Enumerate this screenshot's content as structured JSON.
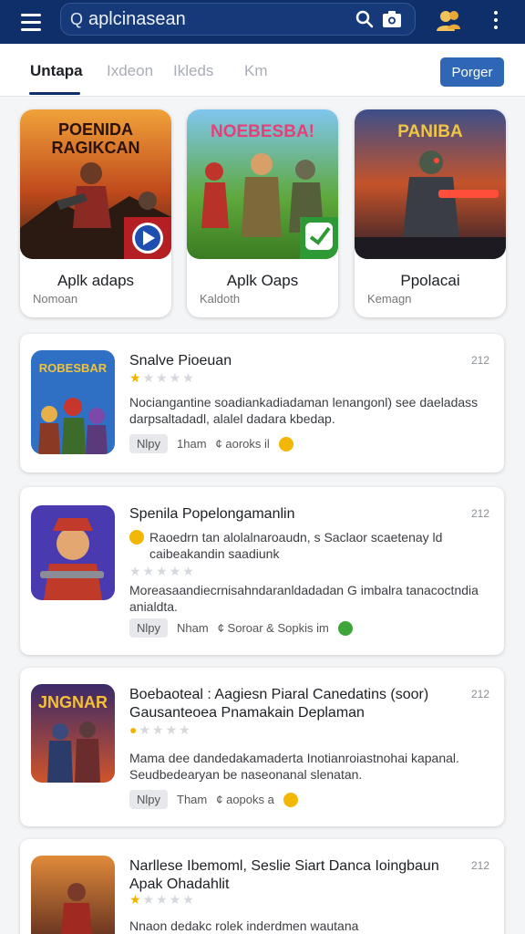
{
  "topbar": {
    "search_text": "aplcinasean",
    "search_prefix": "Q"
  },
  "tabs": [
    {
      "label": "Untapa"
    },
    {
      "label": "Ixdeon"
    },
    {
      "label": "Ikleds"
    },
    {
      "label": "Km"
    }
  ],
  "tab_button": "Porger",
  "featured": [
    {
      "title": "Aplk adaps",
      "sub": "Nomoan",
      "art_text": "POENIDA RAGIKCAN"
    },
    {
      "title": "Aplk Oaps",
      "sub": "Kaldoth",
      "art_text": "NOEBESBA!"
    },
    {
      "title": "Ppolacai",
      "sub": "Kemagn",
      "art_text": "PANIBA"
    }
  ],
  "items": [
    {
      "name": "Snalve Pioeuan",
      "num": "212",
      "rating": 1,
      "desc": "Nociangantine soadiankadiadaman lenangonl) see daeladass darpsaltadadl, alalel dadara kbedap.",
      "chip": "Nlpy",
      "meta1": "1ham",
      "meta2": "¢ aoroks il",
      "badge": "yellow",
      "art_text": "ROBESBAR"
    },
    {
      "name": "Spenila Popelongamanlin",
      "num": "212",
      "line2": "Raoedrn tan alolalnaroaudn, s Saclaor scaetenay ld caibeakandin saadiunk",
      "rating": 0,
      "desc": "Moreasaandiecrnisahndaranldadadan G imbalra tanacoctndia anialdta.",
      "chip": "Nlpy",
      "meta1": "Nham",
      "meta2": "¢ Soroar & Sopkis im",
      "badge": "green",
      "art_text": ""
    },
    {
      "name": "Boebaoteal : Aagiesn Piaral Canedatins (soor) Gausanteoea Pnamakain Deplaman",
      "num": "212",
      "rating": 1,
      "desc": "Mama dee dandedakamaderta Inotianroiastnohai kapanal. Seudbedearyan be naseonanal slenatan.",
      "chip": "Nlpy",
      "meta1": "Tham",
      "meta2": "¢ aopoks a",
      "badge": "yellow",
      "art_text": "JNGNAR"
    },
    {
      "name": "Narllese Ibemoml, Seslie Siart Danca Ioingbaun Apak Ohadahlit",
      "num": "212",
      "rating": 1,
      "desc": "Nnaon dedakc rolek inderdmen wautana",
      "chip": "",
      "meta1": "",
      "meta2": "",
      "badge": "",
      "art_text": ""
    }
  ],
  "colors": {
    "topbar": "#0f2f6b",
    "accent_button": "#2f67b6",
    "star": "#f5b301"
  }
}
